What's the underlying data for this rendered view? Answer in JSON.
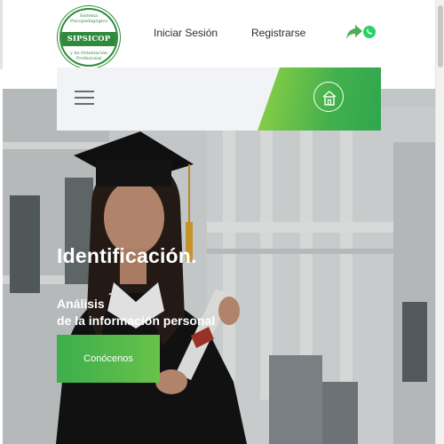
{
  "header": {
    "logo": {
      "banner_text": "SIPSICOP",
      "ring_top": "Sistema Psicopedagógico",
      "ring_bottom": "y de Orientación Profesional"
    },
    "nav": {
      "login_label": "Iniciar Sesión",
      "register_label": "Registrarse"
    },
    "icons": [
      "share-icon",
      "whatsapp-icon"
    ]
  },
  "navbar": {
    "menu_icon": "hamburger-menu-icon",
    "home_icon": "home-icon"
  },
  "hero": {
    "title": "Identificación.",
    "subtitle_line1": "Análisis",
    "subtitle_line2": "de la información personal",
    "cta_label": "Conócenos"
  },
  "colors": {
    "brand_green": "#2f8a3c",
    "accent_green": "#43b04c",
    "light_green": "#8fd246",
    "whatsapp_green": "#25d366"
  }
}
